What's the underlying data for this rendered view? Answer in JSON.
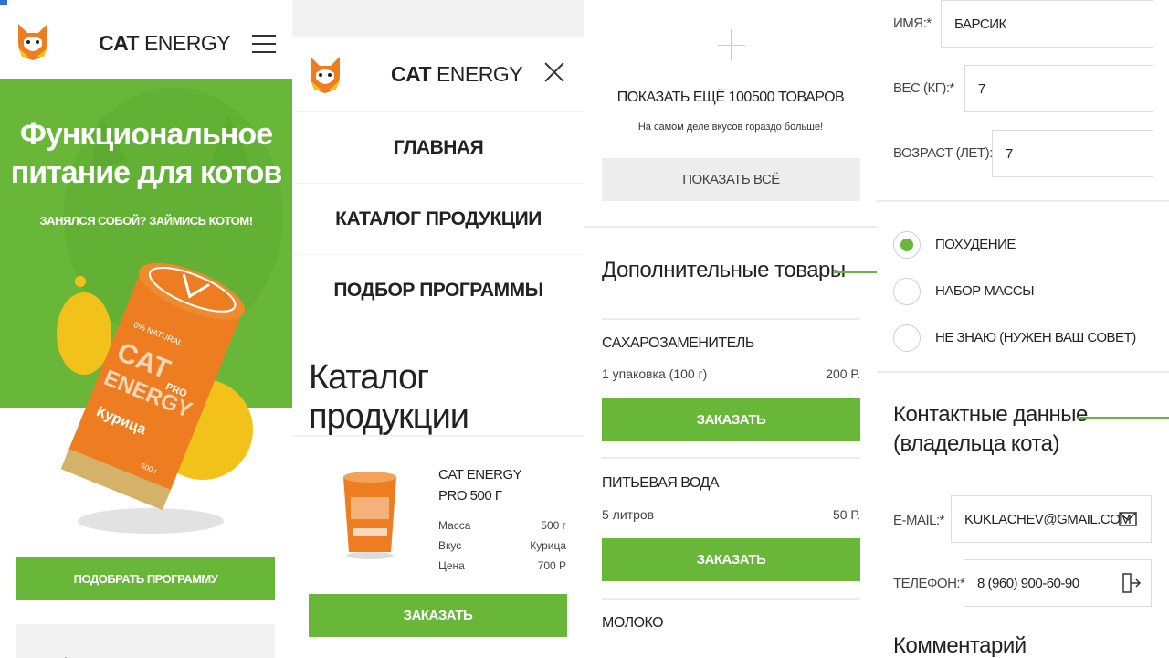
{
  "colors": {
    "accent": "#68b738",
    "yellow": "#f2c21b",
    "orange": "#ee7d22"
  },
  "brand": {
    "bold": "CAT",
    "light": "ENERGY"
  },
  "screen1": {
    "hero_title_line1": "Функциональное",
    "hero_title_line2": "питание для котов",
    "hero_subtitle": "ЗАНЯЛСЯ СОБОЙ? ЗАЙМИСЬ КОТОМ!",
    "product": {
      "label_top": "0% NATURAL",
      "label_cat": "CAT",
      "label_energy": "ENERGY",
      "label_pro": "PRO",
      "label_flavor": "Курица",
      "label_weight": "500 г"
    },
    "cta_label": "ПОДОБРАТЬ ПРОГРАММУ"
  },
  "screen2": {
    "nav": [
      {
        "label": "ГЛАВНАЯ"
      },
      {
        "label": "КАТАЛОГ ПРОДУКЦИИ"
      },
      {
        "label": "ПОДБОР ПРОГРАММЫ"
      }
    ],
    "catalog_title": "Каталог продукции",
    "product": {
      "name_line1": "CAT ENERGY",
      "name_line2": "PRO 500 Г",
      "specs": [
        {
          "key": "Масса",
          "value": "500 г"
        },
        {
          "key": "Вкус",
          "value": "Курица"
        },
        {
          "key": "Цена",
          "value": "700 Р"
        }
      ],
      "order_label": "ЗАКАЗАТЬ"
    }
  },
  "screen3": {
    "more_title": "ПОКАЗАТЬ ЕЩЁ  100500 ТОВАРОВ",
    "more_subtitle": "На самом деле вкусов гораздо больше!",
    "show_all_label": "ПОКАЗАТЬ ВСЁ",
    "extra_title": "Дополнительные товары",
    "items": [
      {
        "name": "САХАРОЗАМЕНИТЕЛЬ",
        "qty": "1 упаковка (100 г)",
        "price": "200 Р.",
        "order_label": "ЗАКАЗАТЬ"
      },
      {
        "name": "ПИТЬЕВАЯ ВОДА",
        "qty": "5 литров",
        "price": "50 Р.",
        "order_label": "ЗАКАЗАТЬ"
      },
      {
        "name": "МОЛОКО"
      }
    ]
  },
  "screen4": {
    "fields": {
      "name_label": "ИМЯ:*",
      "name_value": "БАРСИК",
      "weight_label": "ВЕС (КГ):*",
      "weight_value": "7",
      "age_label": "ВОЗРАСТ (ЛЕТ):",
      "age_value": "7"
    },
    "goals": [
      {
        "label": "ПОХУДЕНИЕ",
        "checked": true
      },
      {
        "label": "НАБОР МАССЫ",
        "checked": false
      },
      {
        "label": "НЕ ЗНАЮ (НУЖЕН ВАШ СОВЕТ)",
        "checked": false
      }
    ],
    "contact_title_line1": "Контактные данные",
    "contact_title_line2": "(владельца кота)",
    "email_label": "E-MAIL:*",
    "email_value": "KUKLACHEV@GMAIL.COM",
    "phone_label": "ТЕЛЕФОН:*",
    "phone_value": "8 (960) 900-60-90",
    "comment_label": "Комментарий"
  }
}
